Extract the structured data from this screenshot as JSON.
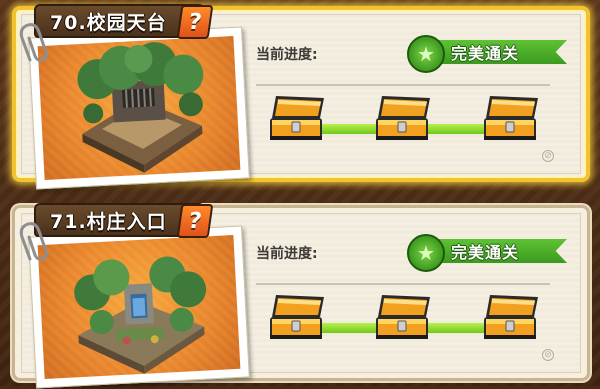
{
  "levels": [
    {
      "title": "70.校园天台",
      "help_symbol": "?",
      "progress_label": "当前进度:",
      "status_text": "完美通关",
      "status_icon": "star-icon",
      "progress_fraction": 1.0,
      "chests_opened": 3,
      "chests_total": 3,
      "selected": true,
      "scene": "rooftop"
    },
    {
      "title": "71.村庄入口",
      "help_symbol": "?",
      "progress_label": "当前进度:",
      "status_text": "完美通关",
      "status_icon": "star-icon",
      "progress_fraction": 1.0,
      "chests_opened": 3,
      "chests_total": 3,
      "selected": false,
      "scene": "village"
    }
  ],
  "colors": {
    "selected_border": "#f3c230",
    "progress_fill": "#8ee02a",
    "perfect_green": "#4aa826",
    "chest_gold": "#f2a020",
    "chest_dark": "#2a2a2a"
  }
}
